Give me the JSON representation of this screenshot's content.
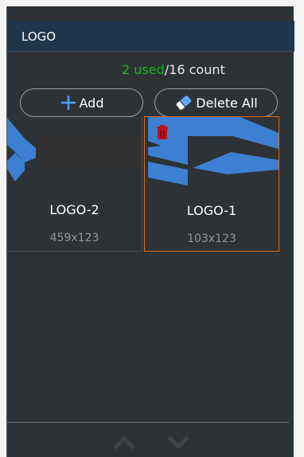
{
  "panel": {
    "title": "LOGO"
  },
  "usage": {
    "used_count": "2",
    "used_word": "used",
    "rest": "/16 count"
  },
  "toolbar": {
    "add_label": "Add",
    "delete_all_label": "Delete All"
  },
  "logos": [
    {
      "name": "LOGO-2",
      "size": "459x123",
      "selected": false
    },
    {
      "name": "LOGO-1",
      "size": "103x123",
      "selected": true
    }
  ],
  "colors": {
    "panel_bg": "#2d3236",
    "title_bg": "#20364c",
    "used_green": "#1bb51b",
    "selection_orange": "#d86a1a",
    "logo_blue": "#3d7fd0"
  },
  "icons": {
    "add": "plus-icon",
    "delete_all": "eraser-icon",
    "thumb_delete": "trash-icon",
    "nav_up": "chevron-up-icon",
    "nav_down": "chevron-down-icon"
  }
}
